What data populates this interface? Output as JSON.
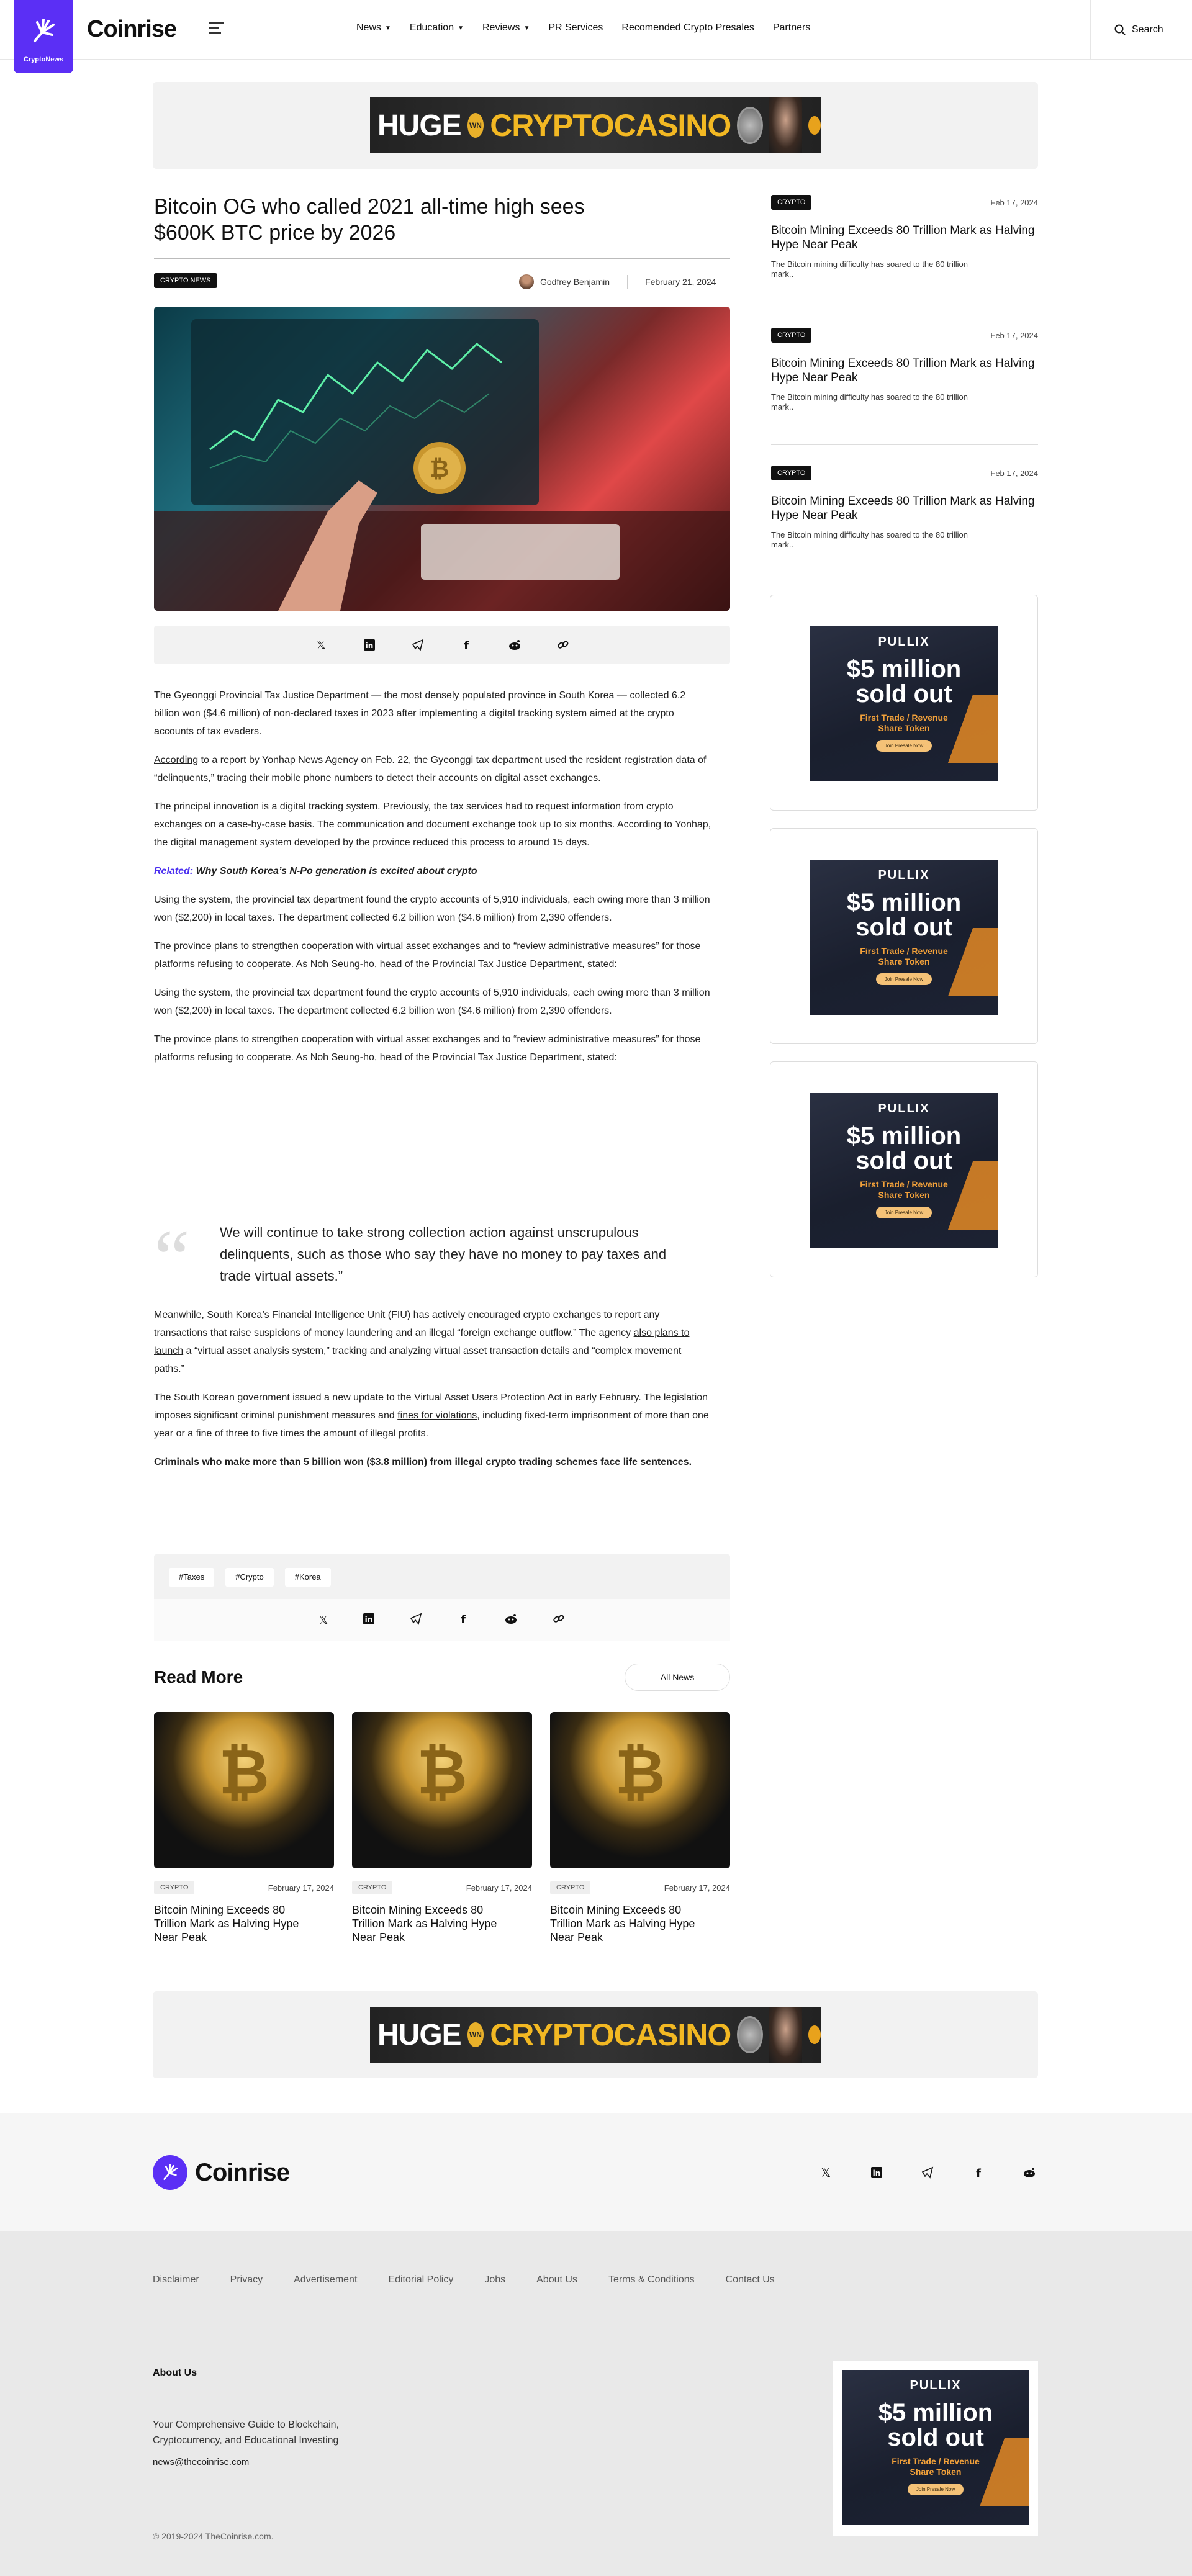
{
  "header": {
    "badge_text": "CryptoNews",
    "brand": "Coinrise",
    "nav": [
      {
        "label": "News",
        "dropdown": true
      },
      {
        "label": "Education",
        "dropdown": true
      },
      {
        "label": "Reviews",
        "dropdown": true
      },
      {
        "label": "PR Services",
        "dropdown": false
      },
      {
        "label": "Recomended Crypto Presales",
        "dropdown": false
      },
      {
        "label": "Partners",
        "dropdown": false
      }
    ],
    "search_label": "Search"
  },
  "banner": {
    "huge": "HUGE",
    "badge": "WN",
    "crypto": "CRYPTOCASINO"
  },
  "article": {
    "title": "Bitcoin OG who called 2021 all-time high sees $600K BTC price by 2026",
    "category": "CRYPTO NEWS",
    "author": "Godfrey Benjamin",
    "date": "February 21, 2024",
    "p1": "The Gyeonggi Provincial Tax Justice Department — the most densely populated province in South Korea — collected 6.2 billion won ($4.6 million) of non-declared taxes in 2023 after implementing a digital tracking system aimed at the crypto accounts of tax evaders.",
    "p2_link": "According",
    "p2_rest": " to a report by Yonhap News Agency on Feb. 22, the Gyeonggi tax department used the resident registration data of “delinquents,” tracing their mobile phone numbers to detect their accounts on digital asset exchanges.",
    "p3": "The principal innovation is a digital tracking system. Previously, the tax services had to request information from crypto exchanges on a case-by-case basis. The communication and document exchange took up to six months. According to Yonhap, the digital management system developed by the province reduced this process to around 15 days.",
    "related_label": "Related:",
    "related_title": "Why South Korea’s N-Po generation is excited about crypto",
    "p4": "Using the system, the provincial tax department found the crypto accounts of 5,910 individuals, each owing more than 3 million won ($2,200) in local taxes. The department collected 6.2 billion won ($4.6 million) from 2,390 offenders.",
    "p5": "The province plans to strengthen cooperation with virtual asset exchanges and to “review administrative measures” for those platforms refusing to cooperate. As Noh Seung-ho, head of the Provincial Tax Justice Department, stated:",
    "p6": "Using the system, the provincial tax department found the crypto accounts of 5,910 individuals, each owing more than 3 million won ($2,200) in local taxes. The department collected 6.2 billion won ($4.6 million) from 2,390 offenders.",
    "p7": "The province plans to strengthen cooperation with virtual asset exchanges and to “review administrative measures” for those platforms refusing to cooperate. As Noh Seung-ho, head of the Provincial Tax Justice Department, stated:",
    "quote": "We will continue to take strong collection action against unscrupulous delinquents, such as those who say they have no money to pay taxes and trade virtual assets.”",
    "p8_a": "Meanwhile, South Korea’s Financial Intelligence Unit (FIU) has actively encouraged crypto exchanges to report any transactions that raise suspicions of money laundering and an illegal “foreign exchange outflow.” The agency ",
    "p8_link": "also plans to launch",
    "p8_b": " a “virtual asset analysis system,” tracking and analyzing virtual asset transaction details and “complex movement paths.”",
    "p9_a": "The South Korean government issued a new update to the Virtual Asset Users Protection Act in early February. The legislation imposes significant criminal punishment measures and ",
    "p9_link": "fines for violations",
    "p9_b": ", including fixed-term imprisonment of more than one year or a fine of three to five times the amount of illegal profits.",
    "p10": "Criminals who make more than 5 billion won ($3.8 million) from illegal crypto trading schemes face life sentences.",
    "tags": [
      "#Taxes",
      "#Crypto",
      "#Korea"
    ]
  },
  "share_icons": [
    "x-icon",
    "linkedin-icon",
    "telegram-icon",
    "facebook-icon",
    "reddit-icon",
    "link-icon"
  ],
  "read_more": {
    "title": "Read More",
    "all_news": "All News",
    "cards": [
      {
        "tag": "CRYPTO",
        "date": "February 17, 2024",
        "title": "Bitcoin Mining Exceeds 80 Trillion Mark as Halving Hype Near Peak"
      },
      {
        "tag": "CRYPTO",
        "date": "February 17, 2024",
        "title": "Bitcoin Mining Exceeds 80 Trillion Mark as Halving Hype Near Peak"
      },
      {
        "tag": "CRYPTO",
        "date": "February 17, 2024",
        "title": "Bitcoin Mining Exceeds 80 Trillion Mark as Halving Hype Near Peak"
      }
    ]
  },
  "sidebar": {
    "items": [
      {
        "tag": "CRYPTO",
        "date": "Feb 17, 2024",
        "title": "Bitcoin Mining Exceeds 80 Trillion Mark as Halving Hype Near Peak",
        "excerpt": "The Bitcoin mining difficulty has soared to the 80 trillion mark.."
      },
      {
        "tag": "CRYPTO",
        "date": "Feb 17, 2024",
        "title": "Bitcoin Mining Exceeds 80 Trillion Mark as Halving Hype Near Peak",
        "excerpt": "The Bitcoin mining difficulty has soared to the 80 trillion mark.."
      },
      {
        "tag": "CRYPTO",
        "date": "Feb 17, 2024",
        "title": "Bitcoin Mining Exceeds 80 Trillion Mark as Halving Hype Near Peak",
        "excerpt": "The Bitcoin mining difficulty has soared to the 80 trillion mark.."
      }
    ]
  },
  "ad": {
    "logo": "PULLIX",
    "headline_1": "$5 million",
    "headline_2": "sold out",
    "sub_1": "First Trade / Revenue",
    "sub_2": "Share Token",
    "button": "Join Presale Now"
  },
  "footer": {
    "brand": "Coinrise",
    "links": [
      "Disclaimer",
      "Privacy",
      "Advertisement",
      "Editorial Policy",
      "Jobs",
      "About Us",
      "Terms & Conditions",
      "Contact Us"
    ],
    "about_title": "About Us",
    "about_text": "Your Comprehensive Guide to Blockchain, Cryptocurrency, and Educational Investing",
    "email": "news@thecoinrise.com",
    "copyright": "© 2019-2024 TheCoinrise.com."
  },
  "colors": {
    "brand_purple": "#5b2ff5",
    "related_blue": "#4b2ff0",
    "panel_gray": "#f2f2f2"
  }
}
